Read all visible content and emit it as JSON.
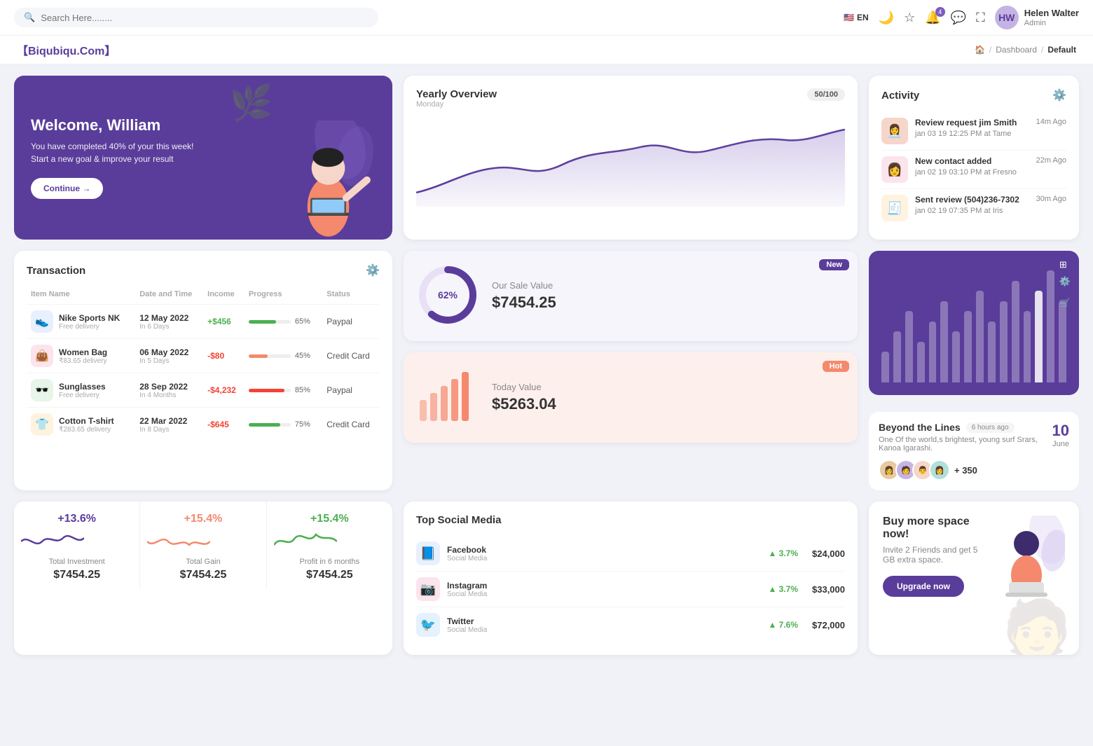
{
  "topnav": {
    "search_placeholder": "Search Here........",
    "lang": "EN",
    "notification_count": "4",
    "user_name": "Helen Walter",
    "user_role": "Admin"
  },
  "breadcrumb": {
    "brand": "【Biqubiqu.Com】",
    "home": "🏠",
    "path1": "Dashboard",
    "path2": "Default"
  },
  "welcome": {
    "title": "Welcome, William",
    "subtitle": "You have completed 40% of your this week! Start a new goal & improve your result",
    "button": "Continue →"
  },
  "yearly_overview": {
    "title": "Yearly Overview",
    "subtitle": "Monday",
    "progress": "50/100"
  },
  "activity": {
    "title": "Activity",
    "items": [
      {
        "title": "Review request jim Smith",
        "subtitle": "jan 03 19 12:25 PM at Tame",
        "time": "14m Ago",
        "emoji": "👤"
      },
      {
        "title": "New contact added",
        "subtitle": "jan 02 19 03:10 PM at Fresno",
        "time": "22m Ago",
        "emoji": "👤"
      },
      {
        "title": "Sent review (504)236-7302",
        "subtitle": "jan 02 19 07:35 PM at Iris",
        "time": "30m Ago",
        "emoji": "📋"
      }
    ]
  },
  "transaction": {
    "title": "Transaction",
    "columns": [
      "Item Name",
      "Date and Time",
      "Income",
      "Progress",
      "Status"
    ],
    "rows": [
      {
        "name": "Nike Sports NK",
        "sub": "Free delivery",
        "date": "12 May 2022",
        "date2": "In 6 Days",
        "income": "+$456",
        "income_type": "pos",
        "progress": 65,
        "progress_color": "#4caf50",
        "status": "Paypal",
        "emoji": "👟"
      },
      {
        "name": "Women Bag",
        "sub": "₹83.65 delivery",
        "date": "06 May 2022",
        "date2": "In 5 Days",
        "income": "-$80",
        "income_type": "neg",
        "progress": 45,
        "progress_color": "#f4896e",
        "status": "Credit Card",
        "emoji": "👜"
      },
      {
        "name": "Sunglasses",
        "sub": "Free delivery",
        "date": "28 Sep 2022",
        "date2": "In 4 Months",
        "income": "-$4,232",
        "income_type": "neg",
        "progress": 85,
        "progress_color": "#f44336",
        "status": "Paypal",
        "emoji": "🕶️"
      },
      {
        "name": "Cotton T-shirt",
        "sub": "₹283.65 delivery",
        "date": "22 Mar 2022",
        "date2": "In 8 Days",
        "income": "-$645",
        "income_type": "neg",
        "progress": 75,
        "progress_color": "#4caf50",
        "status": "Credit Card",
        "emoji": "👕"
      }
    ]
  },
  "sale_new": {
    "badge": "New",
    "donut_pct": "62%",
    "label": "Our Sale Value",
    "value": "$7454.25",
    "donut_fg": "#5a3d9a",
    "donut_bg": "#e8e0f5"
  },
  "sale_hot": {
    "badge": "Hot",
    "label": "Today Value",
    "value": "$5263.04"
  },
  "bar_chart_card": {
    "title": "Beyond the Lines",
    "time_ago": "6 hours ago",
    "description": "One Of the world,s brightest, young surf Srars, Kanoa Igarashi.",
    "plus_count": "+ 350",
    "event_day": "10",
    "event_month": "June",
    "bars": [
      3,
      5,
      7,
      4,
      6,
      8,
      5,
      7,
      9,
      6,
      8,
      10,
      7,
      9,
      11,
      8
    ],
    "avatars": [
      "👩",
      "🧑",
      "👨",
      "👩"
    ]
  },
  "mini_stats": [
    {
      "pct": "+13.6%",
      "color": "blue",
      "label": "Total Investment",
      "value": "$7454.25"
    },
    {
      "pct": "+15.4%",
      "color": "orange",
      "label": "Total Gain",
      "value": "$7454.25"
    },
    {
      "pct": "+15.4%",
      "color": "green",
      "label": "Profit in 6 months",
      "value": "$7454.25"
    }
  ],
  "social_media": {
    "title": "Top Social Media",
    "items": [
      {
        "name": "Facebook",
        "sub": "Social Media",
        "icon": "fb",
        "pct": "3.7%",
        "value": "$24,000"
      },
      {
        "name": "Instagram",
        "sub": "Social Media",
        "icon": "ig",
        "pct": "3.7%",
        "value": "$33,000"
      },
      {
        "name": "Twitter",
        "sub": "Social Media",
        "icon": "tw",
        "pct": "7.6%",
        "value": "$72,000"
      }
    ]
  },
  "upgrade": {
    "title": "Buy more space now!",
    "subtitle": "Invite 2 Friends and get 5 GB extra space.",
    "button": "Upgrade now"
  }
}
